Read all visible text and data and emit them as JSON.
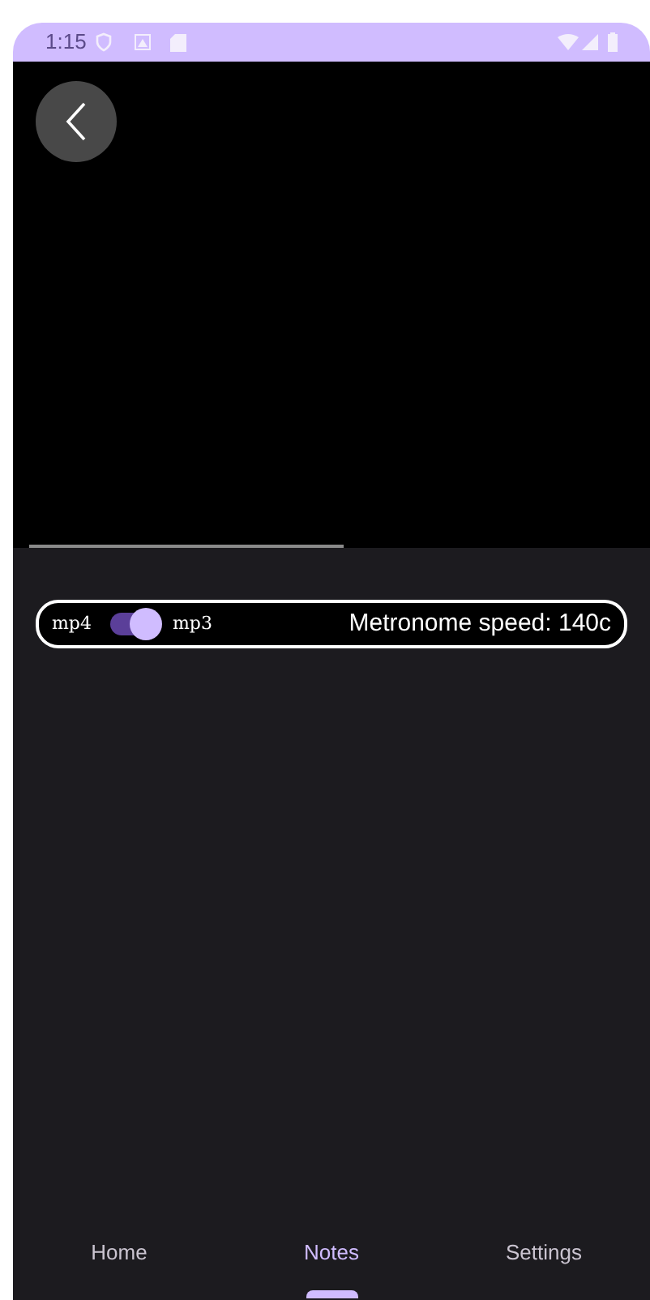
{
  "status_bar": {
    "time": "1:15"
  },
  "video": {
    "progress": {
      "level": 0.52
    }
  },
  "controls": {
    "format_switch": {
      "left_label": "mp4",
      "right_label": "mp3",
      "on": true
    },
    "metronome": "Metronome speed: 140c"
  },
  "nav": [
    {
      "label": "Home",
      "selected": false
    },
    {
      "label": "Notes",
      "selected": true
    },
    {
      "label": "Settings",
      "selected": false
    }
  ]
}
